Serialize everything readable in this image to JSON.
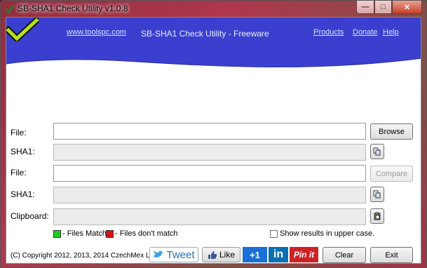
{
  "window": {
    "title": "SB-SHA1 Check Utility  v1.0.8",
    "min_glyph": "—",
    "max_glyph": "□",
    "close_glyph": "✕"
  },
  "banner": {
    "site_link": "www.toolspc.com",
    "title": "SB-SHA1 Check Utility - Freeware",
    "links": [
      "Products",
      "Donate",
      "Help"
    ],
    "bg_color": "#3b3fcf"
  },
  "rows": {
    "file1_label": "File:",
    "sha1a_label": "SHA1:",
    "file2_label": "File:",
    "sha1b_label": "SHA1:",
    "clipboard_label": "Clipboard:"
  },
  "buttons": {
    "browse": "Browse",
    "compare": "Compare",
    "clear": "Clear",
    "exit": "Exit"
  },
  "legend": {
    "match": "- Files Match",
    "nomatch": "- Files don't match",
    "match_color": "#22cc22",
    "nomatch_color": "#dd1111"
  },
  "options": {
    "uppercase_label": "Show results in upper case."
  },
  "footer": {
    "copyright": "(C) Copyright 2012, 2013, 2014 CzechMex LLC"
  },
  "social": {
    "tweet": "Tweet",
    "like": "Like",
    "plusone": "+1",
    "linkedin": "in",
    "pinit": "Pin it"
  }
}
